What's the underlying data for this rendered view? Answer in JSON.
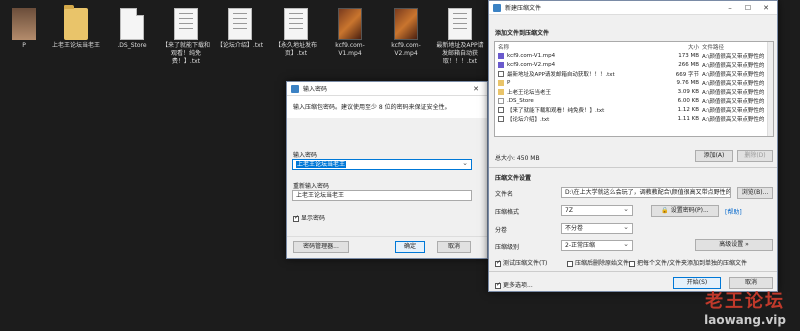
{
  "desktop": {
    "icons": [
      {
        "label": "P",
        "kind": "photo"
      },
      {
        "label": "上老王论坛当老王",
        "kind": "folder"
      },
      {
        "label": ".DS_Store",
        "kind": "doc"
      },
      {
        "label": "【来了就能下载和观看！纯免费！】.txt",
        "kind": "txt"
      },
      {
        "label": "【论坛介绍】.txt",
        "kind": "txt"
      },
      {
        "label": "【永久地址发布页】.txt",
        "kind": "txt"
      },
      {
        "label": "kcf9.com-V1.mp4",
        "kind": "video"
      },
      {
        "label": "kcf9.com-V2.mp4",
        "kind": "video"
      },
      {
        "label": "最新地址及APP请发邮箱自动获取！！！.txt",
        "kind": "txt"
      }
    ]
  },
  "pwd_dialog": {
    "title": "输入密码",
    "desc": "输入压缩包密码。建议使用至少 8 位的密码来保证安全性。",
    "label_enter": "输入密码",
    "value_enter": "上老王论坛当老王",
    "label_reenter": "重新输入密码",
    "value_reenter": "上老王论坛当老王",
    "show_pwd": "显示密码",
    "btn_manager": "密码管理器...",
    "btn_ok": "确定",
    "btn_cancel": "取消"
  },
  "archive_dialog": {
    "title": "新建压缩文件",
    "section_add": "添加文件到压缩文件",
    "col_name": "名称",
    "col_size": "大小",
    "col_path": "文件路径",
    "files": [
      {
        "name": "kcf9.com-V1.mp4",
        "size": "173 MB",
        "path": "A:\\颜值很高又带点野性的",
        "icon": "video"
      },
      {
        "name": "kcf9.com-V2.mp4",
        "size": "266 MB",
        "path": "A:\\颜值很高又带点野性的",
        "icon": "video"
      },
      {
        "name": "最新地址及APP请发邮箱自动获取！！！.txt",
        "size": "669 字节",
        "path": "A:\\颜值很高又带点野性的",
        "icon": "txt"
      },
      {
        "name": "P",
        "size": "9.76 MB",
        "path": "A:\\颜值很高又带点野性的",
        "icon": "folder"
      },
      {
        "name": "上老王论坛当老王",
        "size": "3.09 KB",
        "path": "A:\\颜值很高又带点野性的",
        "icon": "folder"
      },
      {
        "name": ".DS_Store",
        "size": "6.00 KB",
        "path": "A:\\颜值很高又带点野性的",
        "icon": "file"
      },
      {
        "name": "【来了就能下载和观看！纯免费！】.txt",
        "size": "1.12 KB",
        "path": "A:\\颜值很高又带点野性的",
        "icon": "txt"
      },
      {
        "name": "【论坛介绍】.txt",
        "size": "1.11 KB",
        "path": "A:\\颜值很高又带点野性的",
        "icon": "txt"
      }
    ],
    "total_size": "总大小: 450 MB",
    "btn_add": "添加(A)",
    "btn_delete": "删除(D)",
    "section_settings": "压缩文件设置",
    "label_filename": "文件名",
    "value_filename": "D:\\在上大学就这么会玩了，调教教配合\\颜值很高又带点野性的",
    "btn_browse": "浏览(B)...",
    "label_format": "压缩格式",
    "value_format": "7Z",
    "btn_set_pwd": "设置密码(P)...",
    "link_help": "[帮助]",
    "label_split": "分卷",
    "value_split": "不分卷",
    "label_level": "压缩级别",
    "value_level": "2-正常压缩",
    "btn_advanced": "高级设置 »",
    "chk_test": "测试压缩文件(T)",
    "chk_delete": "压缩后删除原始文件",
    "chk_separate": "把每个文件/文件夹添加到单独的压缩文件",
    "chk_more": "更多选项...",
    "btn_start": "开始(S)",
    "btn_cancel": "取消"
  },
  "watermark": {
    "line1": "老王论坛",
    "line2": "laowang.vip"
  }
}
